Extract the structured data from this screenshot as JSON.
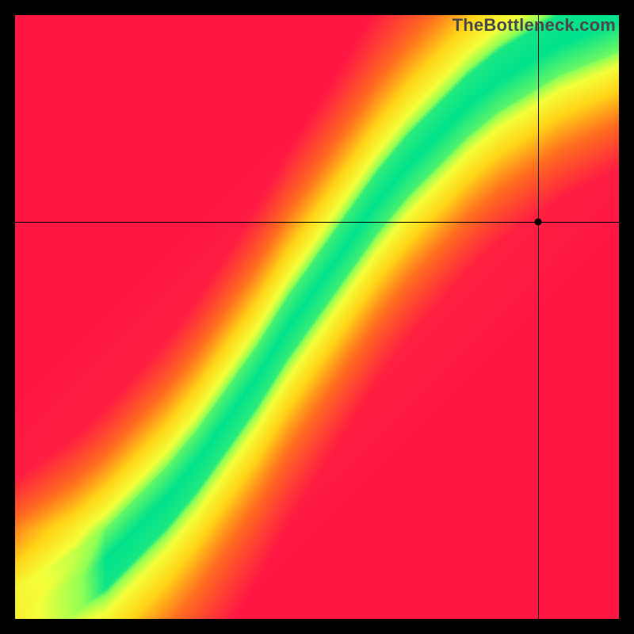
{
  "watermark": "TheBottleneck.com",
  "chart_data": {
    "type": "heatmap",
    "title": "",
    "xlabel": "",
    "ylabel": "",
    "xlim": [
      0,
      1
    ],
    "ylim": [
      0,
      1
    ],
    "grid": false,
    "legend": false,
    "colormap_stops": [
      {
        "t": 0.0,
        "color": "#ff1744"
      },
      {
        "t": 0.3,
        "color": "#ff6d1f"
      },
      {
        "t": 0.55,
        "color": "#ffd417"
      },
      {
        "t": 0.78,
        "color": "#f4ff3a"
      },
      {
        "t": 0.92,
        "color": "#8fff55"
      },
      {
        "t": 1.0,
        "color": "#00e28c"
      }
    ],
    "ridge": {
      "description": "Green optimal band center y(x), normalized 0..1 with origin at bottom-left. Band is a narrow S-curve from origin to upper-right; width ~0.04–0.08.",
      "points": [
        {
          "x": 0.0,
          "y": 0.0
        },
        {
          "x": 0.05,
          "y": 0.03
        },
        {
          "x": 0.1,
          "y": 0.06
        },
        {
          "x": 0.15,
          "y": 0.1
        },
        {
          "x": 0.2,
          "y": 0.15
        },
        {
          "x": 0.25,
          "y": 0.2
        },
        {
          "x": 0.3,
          "y": 0.26
        },
        {
          "x": 0.35,
          "y": 0.33
        },
        {
          "x": 0.4,
          "y": 0.4
        },
        {
          "x": 0.45,
          "y": 0.48
        },
        {
          "x": 0.5,
          "y": 0.55
        },
        {
          "x": 0.55,
          "y": 0.62
        },
        {
          "x": 0.6,
          "y": 0.69
        },
        {
          "x": 0.65,
          "y": 0.75
        },
        {
          "x": 0.7,
          "y": 0.8
        },
        {
          "x": 0.75,
          "y": 0.85
        },
        {
          "x": 0.8,
          "y": 0.89
        },
        {
          "x": 0.85,
          "y": 0.92
        },
        {
          "x": 0.9,
          "y": 0.95
        },
        {
          "x": 0.95,
          "y": 0.97
        },
        {
          "x": 1.0,
          "y": 0.99
        }
      ],
      "half_width": 0.05
    },
    "background_falloff": {
      "description": "Outside the green ridge the field transitions yellow→orange→red; lower-left and upper-left/far-lower-right are deepest red."
    },
    "crosshair": {
      "x": 0.866,
      "y": 0.658
    },
    "marker": {
      "x": 0.866,
      "y": 0.658
    }
  }
}
